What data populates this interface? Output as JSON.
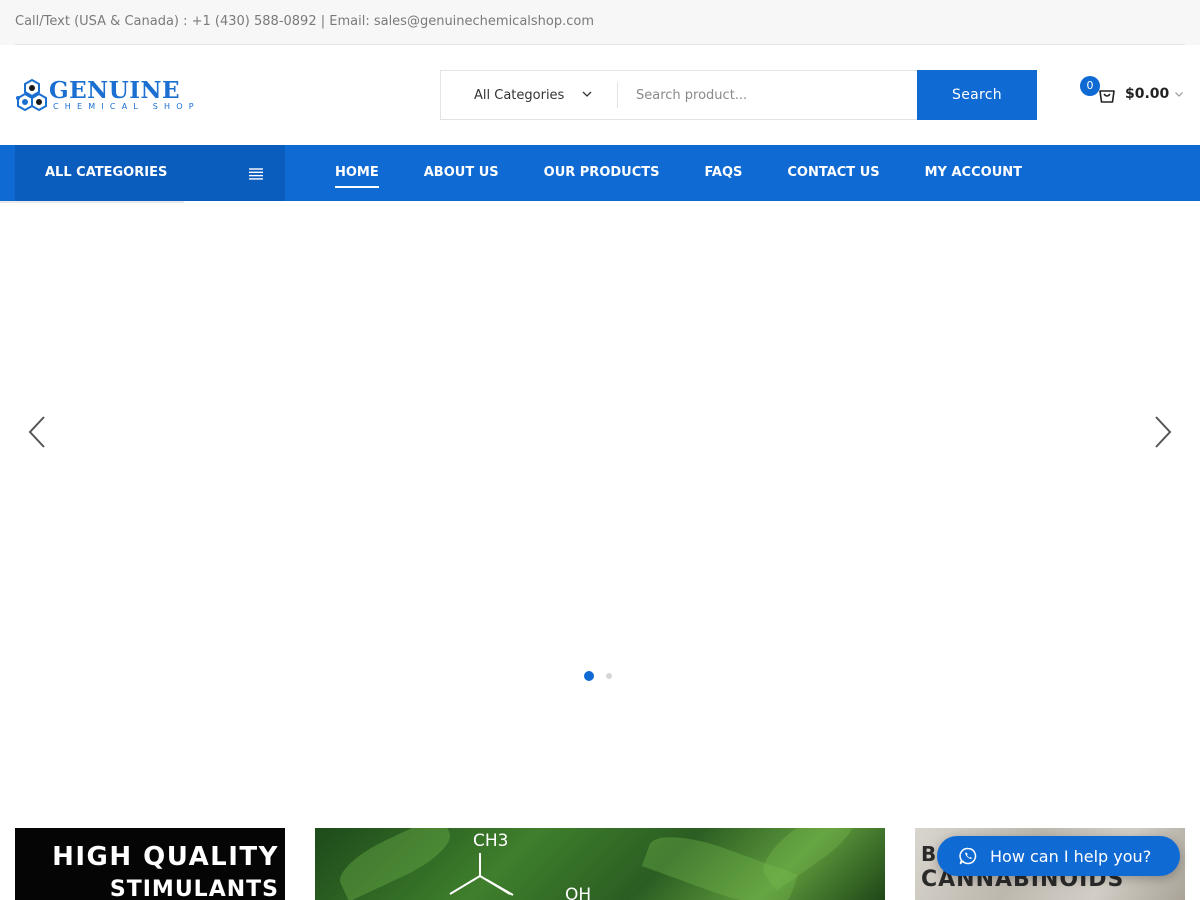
{
  "topbar": {
    "contact_text": "Call/Text (USA & Canada) : +1 (430) 588-0892 | Email: sales@genuinechemicalshop.com"
  },
  "logo": {
    "brand": "GENUINE",
    "sub": "CHEMICAL SHOP",
    "icon": "molecule-logo-icon"
  },
  "search": {
    "category": "All Categories",
    "placeholder": "Search product...",
    "button_label": "Search"
  },
  "cart": {
    "count": "0",
    "amount": "$0.00",
    "icon": "shopping-bag-icon"
  },
  "nav": {
    "all_categories": "ALL CATEGORIES",
    "items": [
      {
        "label": "HOME",
        "active": true
      },
      {
        "label": "ABOUT US"
      },
      {
        "label": "OUR PRODUCTS"
      },
      {
        "label": "FAQS"
      },
      {
        "label": "CONTACT US"
      },
      {
        "label": "MY ACCOUNT"
      }
    ]
  },
  "slider": {
    "slide_count": 2,
    "active_slide": 1
  },
  "banners": {
    "stimulants": {
      "line1": "HIGH QUALITY",
      "line2": "STIMULANTS"
    },
    "cannabis": {
      "ch3": "CH3",
      "oh": "OH"
    },
    "cannabinoids": {
      "line1": "B",
      "line2": "CANNABINOIDS"
    }
  },
  "chat": {
    "label": "How can I help you?",
    "icon": "whatsapp-icon"
  },
  "colors": {
    "primary": "#0f6ad3",
    "primary_dark": "#0b5dbd",
    "topbar_bg": "#f7f7f7",
    "muted_text": "#7a7a7a"
  }
}
